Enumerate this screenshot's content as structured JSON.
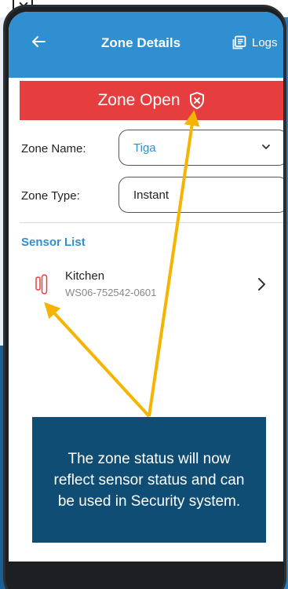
{
  "app_bar": {
    "title": "Zone Details",
    "logs_label": "Logs",
    "back_icon": "arrow-left-icon",
    "logs_icon": "logs-icon"
  },
  "status": {
    "text": "Zone Open",
    "icon": "shield-x-icon",
    "color": "#e63e3e"
  },
  "zone_name": {
    "label": "Zone Name:",
    "value": "Tiga"
  },
  "zone_type": {
    "label": "Zone Type:",
    "value": "Instant"
  },
  "sensor_list": {
    "title": "Sensor List",
    "items": [
      {
        "name": "Kitchen",
        "id": "WS06-752542-0601",
        "icon": "door-sensor-icon"
      }
    ]
  },
  "callout": {
    "text": "The zone status will now reflect sensor status and can be used in Security system."
  },
  "colors": {
    "accent": "#2f8fd1",
    "callout_bg": "#0f4d75",
    "arrow": "#f5b400"
  }
}
